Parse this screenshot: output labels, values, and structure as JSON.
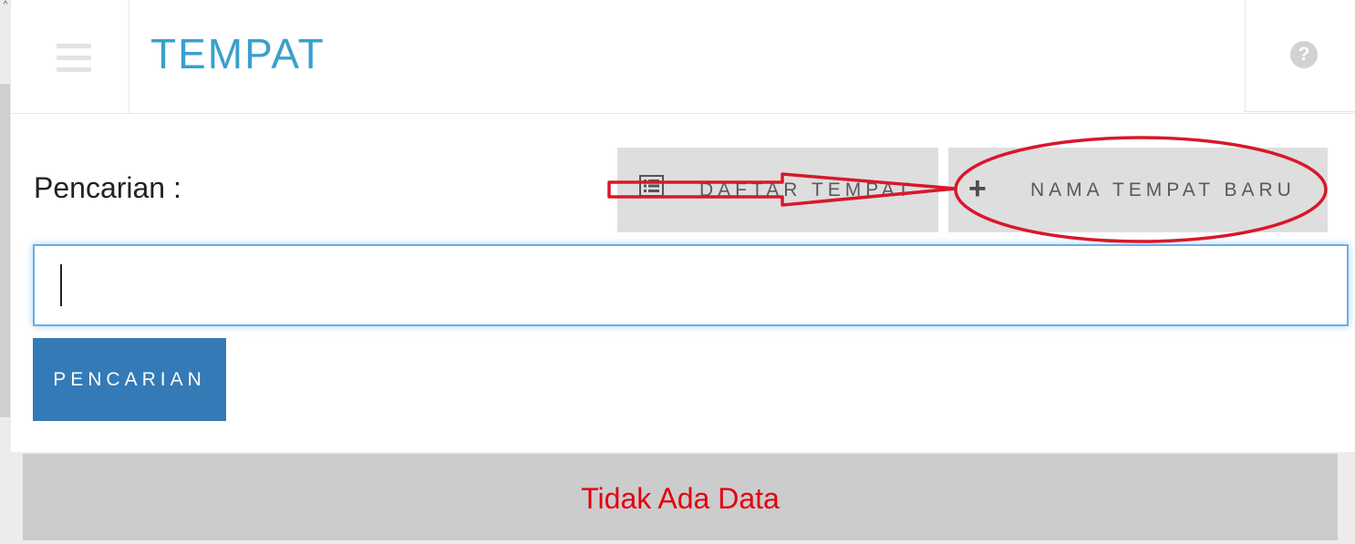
{
  "header": {
    "title": "TEMPAT",
    "menu_icon": "hamburger-menu-icon",
    "help_icon": "question-circle-icon",
    "help_glyph": "?"
  },
  "search": {
    "label": "Pencarian :",
    "input_value": "",
    "button_label": "PENCARIAN"
  },
  "actions": {
    "list_button_label": "DAFTAR TEMPAT",
    "list_icon": "list-icon",
    "new_button_label": "NAMA TEMPAT BARU",
    "new_icon": "plus-icon"
  },
  "results": {
    "empty_message": "Tidak Ada Data"
  },
  "colors": {
    "title": "#3aa0cc",
    "primary_button": "#337ab7",
    "empty_message": "#e3000f",
    "annotation": "#d8182a"
  }
}
